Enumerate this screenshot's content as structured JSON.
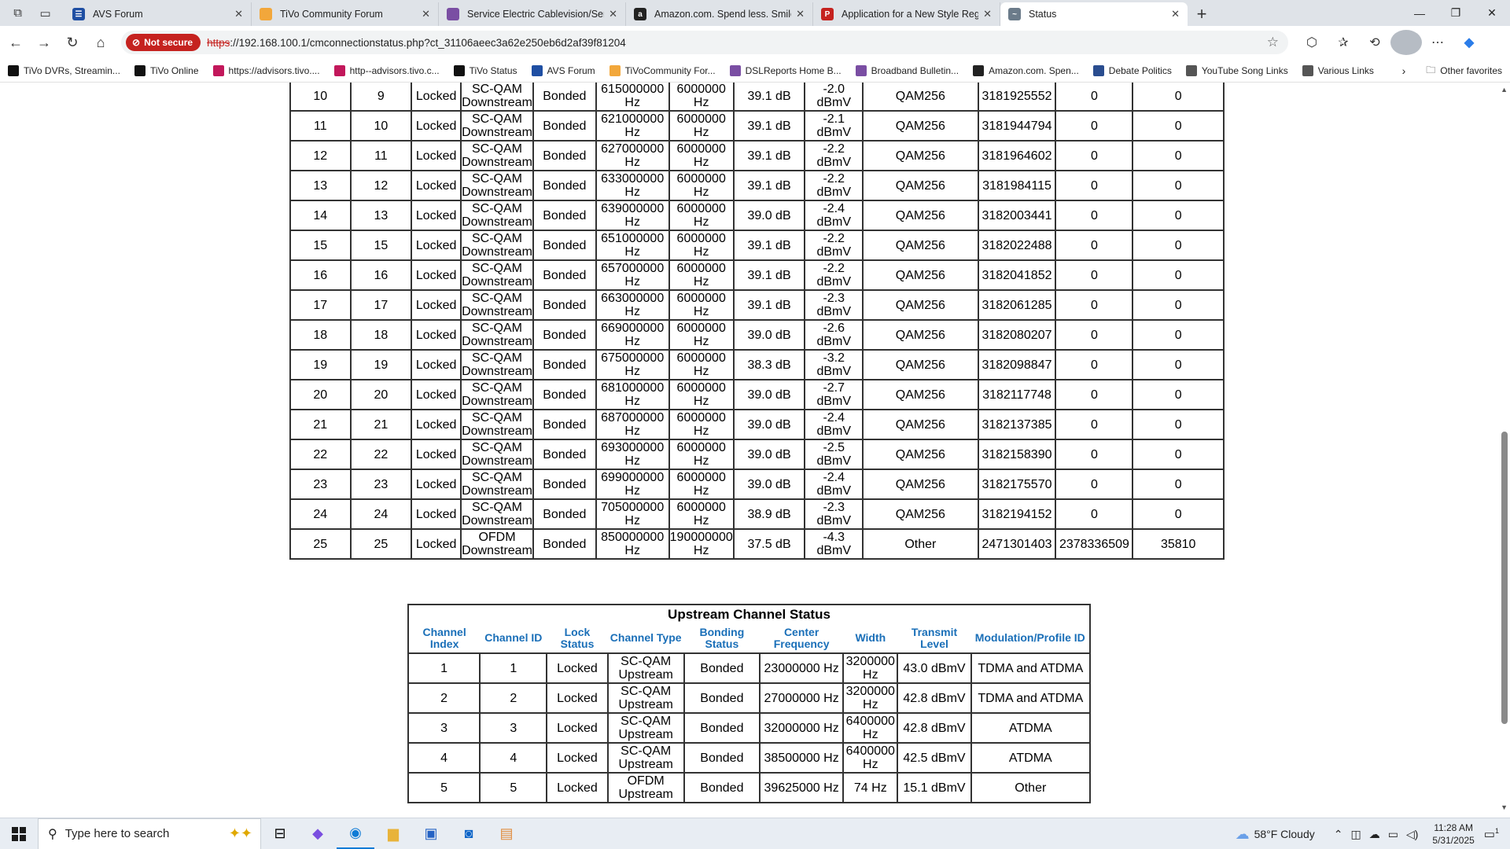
{
  "tabs": [
    {
      "title": "AVS Forum",
      "color": "#1f4fa3",
      "glyph": "☰"
    },
    {
      "title": "TiVo Community Forum",
      "color": "#f2a73b",
      "glyph": ""
    },
    {
      "title": "Service Electric Cablevision/Servic",
      "color": "#7a4ea3",
      "glyph": ""
    },
    {
      "title": "Amazon.com. Spend less. Smile m",
      "color": "#222222",
      "glyph": "a"
    },
    {
      "title": "Application for a New Style Regist",
      "color": "#c5221f",
      "glyph": "P"
    },
    {
      "title": "Status",
      "color": "#6b7b8a",
      "glyph": "~"
    }
  ],
  "address": {
    "badge": "Not secure",
    "scheme": "https",
    "rest": "://192.168.100.1/cmconnectionstatus.php?ct_31106aeec3a62e250eb6d2af39f81204"
  },
  "bookmarks": [
    {
      "label": "TiVo DVRs, Streamin...",
      "color": "#111"
    },
    {
      "label": "TiVo Online",
      "color": "#111"
    },
    {
      "label": "https://advisors.tivo....",
      "color": "#c2185b"
    },
    {
      "label": "http--advisors.tivo.c...",
      "color": "#c2185b"
    },
    {
      "label": "TiVo Status",
      "color": "#111"
    },
    {
      "label": "AVS Forum",
      "color": "#1f4fa3"
    },
    {
      "label": "TiVoCommunity For...",
      "color": "#f2a73b"
    },
    {
      "label": "DSLReports Home B...",
      "color": "#7a4ea3"
    },
    {
      "label": "Broadband Bulletin...",
      "color": "#7a4ea3"
    },
    {
      "label": "Amazon.com. Spen...",
      "color": "#222"
    },
    {
      "label": "Debate Politics",
      "color": "#2a4d8f"
    },
    {
      "label": "YouTube Song Links",
      "color": "#555"
    },
    {
      "label": "Various Links",
      "color": "#555"
    }
  ],
  "bookmarks_other": "Other favorites",
  "downstream": {
    "rows": [
      [
        "10",
        "9",
        "Locked",
        "SC-QAM Downstream",
        "Bonded",
        "615000000 Hz",
        "6000000 Hz",
        "39.1 dB",
        "-2.0 dBmV",
        "QAM256",
        "3181925552",
        "0",
        "0"
      ],
      [
        "11",
        "10",
        "Locked",
        "SC-QAM Downstream",
        "Bonded",
        "621000000 Hz",
        "6000000 Hz",
        "39.1 dB",
        "-2.1 dBmV",
        "QAM256",
        "3181944794",
        "0",
        "0"
      ],
      [
        "12",
        "11",
        "Locked",
        "SC-QAM Downstream",
        "Bonded",
        "627000000 Hz",
        "6000000 Hz",
        "39.1 dB",
        "-2.2 dBmV",
        "QAM256",
        "3181964602",
        "0",
        "0"
      ],
      [
        "13",
        "12",
        "Locked",
        "SC-QAM Downstream",
        "Bonded",
        "633000000 Hz",
        "6000000 Hz",
        "39.1 dB",
        "-2.2 dBmV",
        "QAM256",
        "3181984115",
        "0",
        "0"
      ],
      [
        "14",
        "13",
        "Locked",
        "SC-QAM Downstream",
        "Bonded",
        "639000000 Hz",
        "6000000 Hz",
        "39.0 dB",
        "-2.4 dBmV",
        "QAM256",
        "3182003441",
        "0",
        "0"
      ],
      [
        "15",
        "15",
        "Locked",
        "SC-QAM Downstream",
        "Bonded",
        "651000000 Hz",
        "6000000 Hz",
        "39.1 dB",
        "-2.2 dBmV",
        "QAM256",
        "3182022488",
        "0",
        "0"
      ],
      [
        "16",
        "16",
        "Locked",
        "SC-QAM Downstream",
        "Bonded",
        "657000000 Hz",
        "6000000 Hz",
        "39.1 dB",
        "-2.2 dBmV",
        "QAM256",
        "3182041852",
        "0",
        "0"
      ],
      [
        "17",
        "17",
        "Locked",
        "SC-QAM Downstream",
        "Bonded",
        "663000000 Hz",
        "6000000 Hz",
        "39.1 dB",
        "-2.3 dBmV",
        "QAM256",
        "3182061285",
        "0",
        "0"
      ],
      [
        "18",
        "18",
        "Locked",
        "SC-QAM Downstream",
        "Bonded",
        "669000000 Hz",
        "6000000 Hz",
        "39.0 dB",
        "-2.6 dBmV",
        "QAM256",
        "3182080207",
        "0",
        "0"
      ],
      [
        "19",
        "19",
        "Locked",
        "SC-QAM Downstream",
        "Bonded",
        "675000000 Hz",
        "6000000 Hz",
        "38.3 dB",
        "-3.2 dBmV",
        "QAM256",
        "3182098847",
        "0",
        "0"
      ],
      [
        "20",
        "20",
        "Locked",
        "SC-QAM Downstream",
        "Bonded",
        "681000000 Hz",
        "6000000 Hz",
        "39.0 dB",
        "-2.7 dBmV",
        "QAM256",
        "3182117748",
        "0",
        "0"
      ],
      [
        "21",
        "21",
        "Locked",
        "SC-QAM Downstream",
        "Bonded",
        "687000000 Hz",
        "6000000 Hz",
        "39.0 dB",
        "-2.4 dBmV",
        "QAM256",
        "3182137385",
        "0",
        "0"
      ],
      [
        "22",
        "22",
        "Locked",
        "SC-QAM Downstream",
        "Bonded",
        "693000000 Hz",
        "6000000 Hz",
        "39.0 dB",
        "-2.5 dBmV",
        "QAM256",
        "3182158390",
        "0",
        "0"
      ],
      [
        "23",
        "23",
        "Locked",
        "SC-QAM Downstream",
        "Bonded",
        "699000000 Hz",
        "6000000 Hz",
        "39.0 dB",
        "-2.4 dBmV",
        "QAM256",
        "3182175570",
        "0",
        "0"
      ],
      [
        "24",
        "24",
        "Locked",
        "SC-QAM Downstream",
        "Bonded",
        "705000000 Hz",
        "6000000 Hz",
        "38.9 dB",
        "-2.3 dBmV",
        "QAM256",
        "3182194152",
        "0",
        "0"
      ],
      [
        "25",
        "25",
        "Locked",
        "OFDM Downstream",
        "Bonded",
        "850000000 Hz",
        "190000000 Hz",
        "37.5 dB",
        "-4.3 dBmV",
        "Other",
        "2471301403",
        "2378336509",
        "35810"
      ]
    ]
  },
  "upstream": {
    "caption": "Upstream Channel Status",
    "headers": [
      "Channel Index",
      "Channel ID",
      "Lock Status",
      "Channel Type",
      "Bonding Status",
      "Center Frequency",
      "Width",
      "Transmit Level",
      "Modulation/Profile ID"
    ],
    "rows": [
      [
        "1",
        "1",
        "Locked",
        "SC-QAM Upstream",
        "Bonded",
        "23000000 Hz",
        "3200000 Hz",
        "43.0 dBmV",
        "TDMA and ATDMA"
      ],
      [
        "2",
        "2",
        "Locked",
        "SC-QAM Upstream",
        "Bonded",
        "27000000 Hz",
        "3200000 Hz",
        "42.8 dBmV",
        "TDMA and ATDMA"
      ],
      [
        "3",
        "3",
        "Locked",
        "SC-QAM Upstream",
        "Bonded",
        "32000000 Hz",
        "6400000 Hz",
        "42.8 dBmV",
        "ATDMA"
      ],
      [
        "4",
        "4",
        "Locked",
        "SC-QAM Upstream",
        "Bonded",
        "38500000 Hz",
        "6400000 Hz",
        "42.5 dBmV",
        "ATDMA"
      ],
      [
        "5",
        "5",
        "Locked",
        "OFDM Upstream",
        "Bonded",
        "39625000 Hz",
        "74 Hz",
        "15.1 dBmV",
        "Other"
      ]
    ]
  },
  "taskbar": {
    "search_placeholder": "Type here to search",
    "weather": "58°F  Cloudy",
    "time": "11:28 AM",
    "date": "5/31/2025",
    "notif_count": "1"
  }
}
